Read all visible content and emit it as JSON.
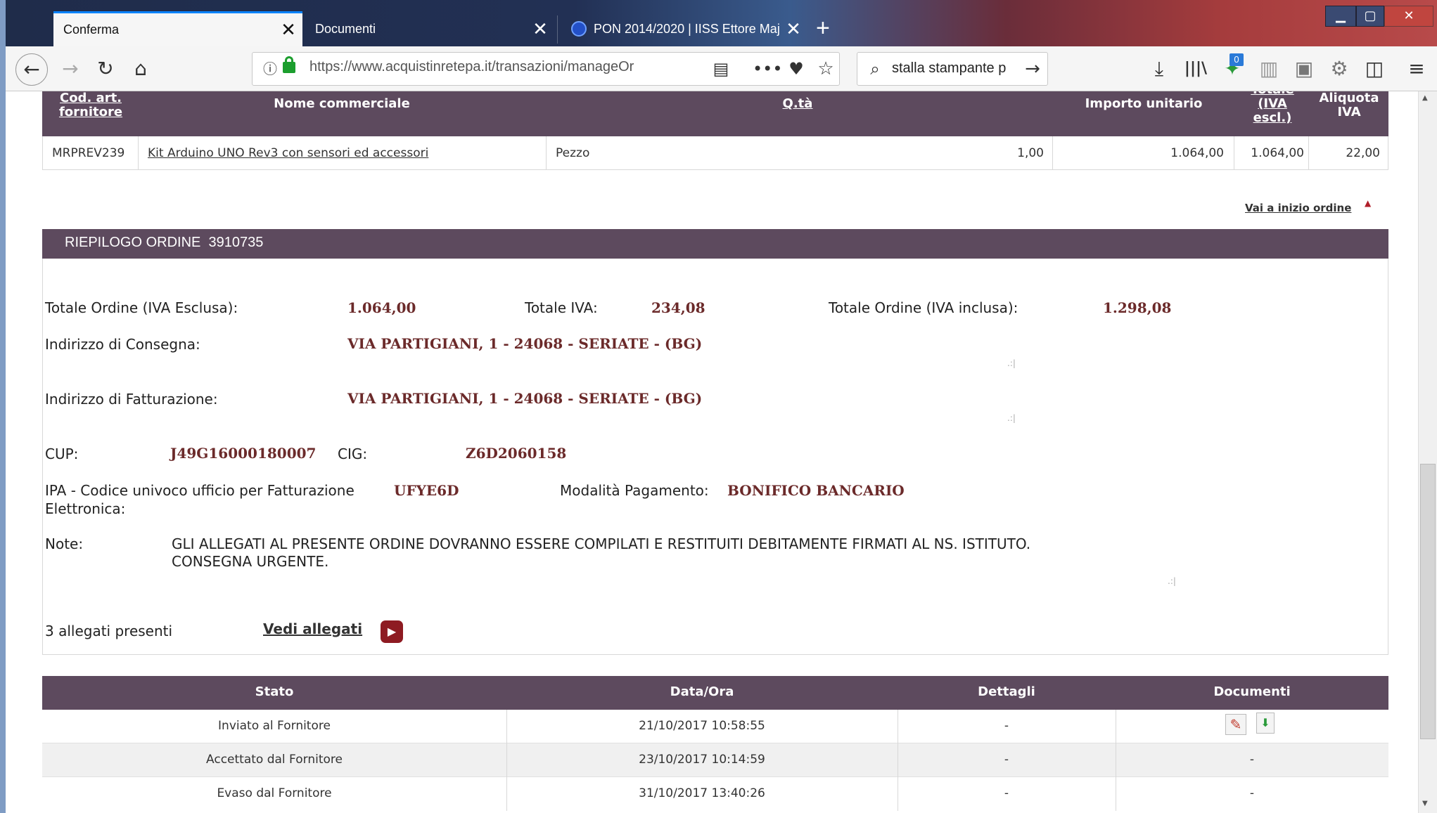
{
  "browser": {
    "tabs": [
      {
        "label": "Conferma"
      },
      {
        "label": "Documenti"
      },
      {
        "label": "PON 2014/2020 | IISS Ettore Maj"
      }
    ],
    "url": "https://www.acquistinretepa.it/transazioni/manageOr",
    "search": "stalla stampante p",
    "badge_count": "0"
  },
  "items_table": {
    "headers": {
      "code": [
        "Cod. art.",
        "fornitore"
      ],
      "name": "Nome commerciale",
      "qty": "Q.tà",
      "unit_price": "Importo unitario",
      "total": [
        "Totale",
        "(IVA",
        "escl.)"
      ],
      "vat": [
        "Aliquota",
        "IVA"
      ]
    },
    "row": {
      "code": "MRPREV239",
      "name": "Kit Arduino UNO Rev3 con sensori ed accessori",
      "unit": "Pezzo",
      "qty": "1,00",
      "unit_price": "1.064,00",
      "total": "1.064,00",
      "vat": "22,00"
    }
  },
  "back_to_top": "Vai a inizio ordine",
  "summary": {
    "title": "RIEPILOGO ORDINE",
    "order_number": "3910735",
    "total_ex_label": "Totale Ordine (IVA Esclusa):",
    "total_ex": "1.064,00",
    "vat_label": "Totale IVA:",
    "vat": "234,08",
    "total_inc_label": "Totale Ordine (IVA inclusa):",
    "total_inc": "1.298,08",
    "delivery_label": "Indirizzo di Consegna:",
    "delivery": "VIA PARTIGIANI, 1 - 24068 - SERIATE - (BG)",
    "billing_label": "Indirizzo di Fatturazione:",
    "billing": "VIA PARTIGIANI, 1 - 24068 - SERIATE - (BG)",
    "cup_label": "CUP:",
    "cup": "J49G16000180007",
    "cig_label": "CIG:",
    "cig": "Z6D2060158",
    "ipa_label_1": "IPA - Codice univoco ufficio per Fatturazione",
    "ipa_label_2": "Elettronica:",
    "ipa": "UFYE6D",
    "payment_label": "Modalità Pagamento:",
    "payment": "BONIFICO BANCARIO",
    "notes_label": "Note:",
    "notes_1": "GLI ALLEGATI AL PRESENTE ORDINE DOVRANNO ESSERE COMPILATI E RESTITUITI DEBITAMENTE FIRMATI AL NS. ISTITUTO.",
    "notes_2": "CONSEGNA URGENTE.",
    "attachments_text": "3 allegati presenti",
    "attachments_link": "Vedi allegati"
  },
  "status_table": {
    "headers": [
      "Stato",
      "Data/Ora",
      "Dettagli",
      "Documenti"
    ],
    "rows": [
      {
        "stato": "Inviato al Fornitore",
        "data": "21/10/2017 10:58:55",
        "dettagli": "-",
        "documenti": ""
      },
      {
        "stato": "Accettato dal Fornitore",
        "data": "23/10/2017 10:14:59",
        "dettagli": "-",
        "documenti": "-"
      },
      {
        "stato": "Evaso dal Fornitore",
        "data": "31/10/2017 13:40:26",
        "dettagli": "-",
        "documenti": "-"
      }
    ]
  },
  "colors": {
    "header_bg": "#5d4a5e",
    "value_text": "#6b2a2a",
    "accent_red": "#b01e2a"
  }
}
